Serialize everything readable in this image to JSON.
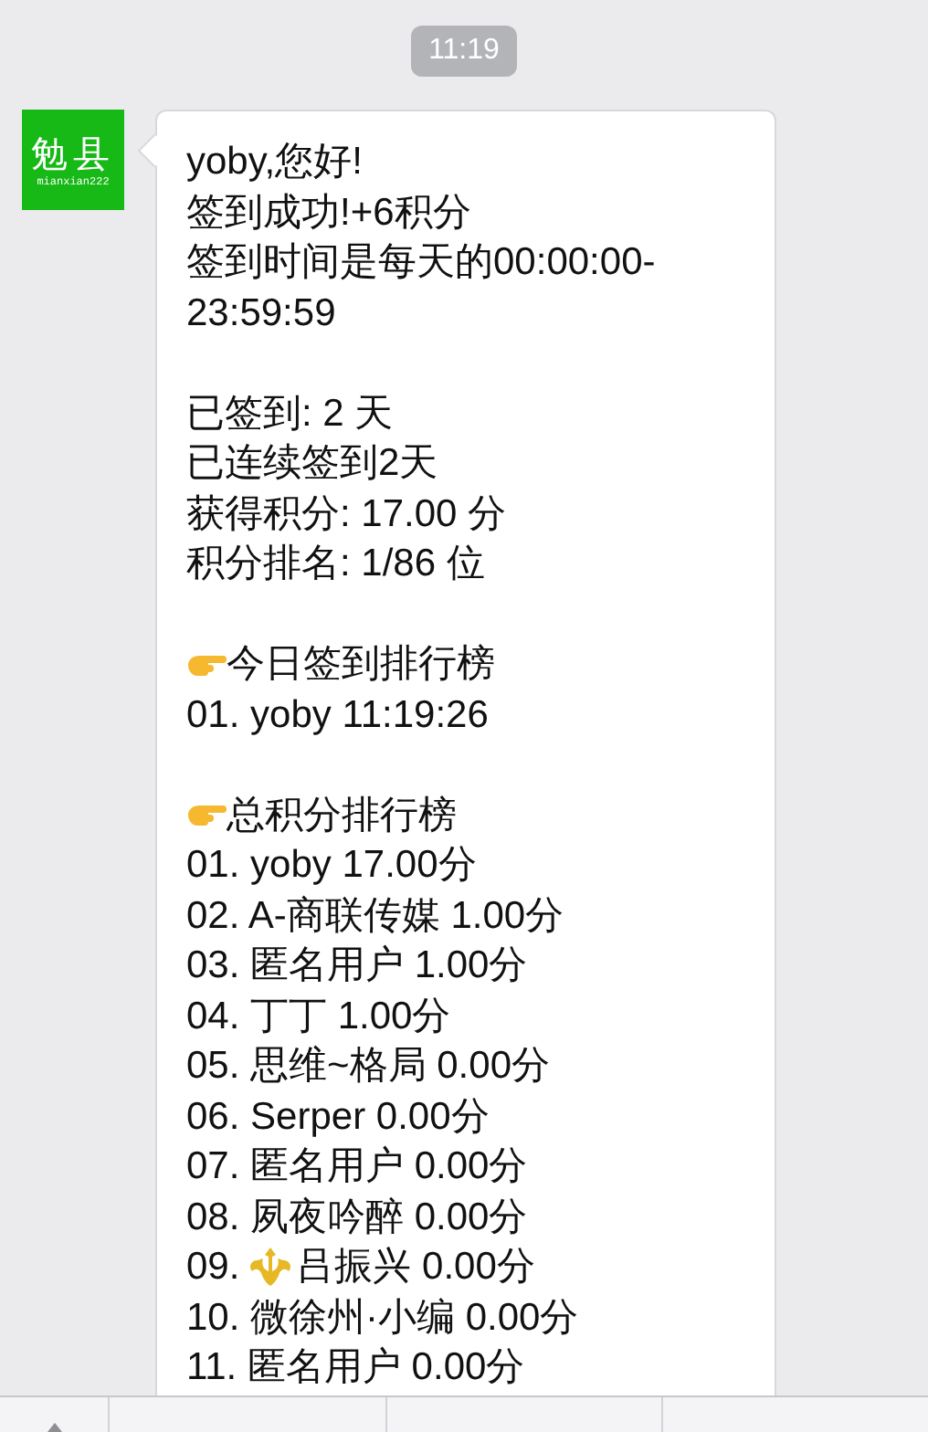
{
  "time_stamp": "11:19",
  "message": {
    "sender_avatar": {
      "title": "勉县",
      "subtitle": "mianxian222"
    },
    "lines": [
      {
        "kind": "plain",
        "text": "yoby,您好!"
      },
      {
        "kind": "plain",
        "text": "签到成功!+6积分"
      },
      {
        "kind": "plain",
        "text": "签到时间是每天的00:00:00-23:59:59"
      },
      {
        "kind": "blank"
      },
      {
        "kind": "plain",
        "text": "已签到: 2 天"
      },
      {
        "kind": "plain",
        "text": "已连续签到2天"
      },
      {
        "kind": "plain",
        "text": "获得积分: 17.00 分"
      },
      {
        "kind": "plain",
        "text": "积分排名: 1/86 位"
      },
      {
        "kind": "blank"
      },
      {
        "kind": "pointer",
        "text": "今日签到排行榜"
      },
      {
        "kind": "plain",
        "text": "01. yoby 11:19:26"
      },
      {
        "kind": "blank"
      },
      {
        "kind": "pointer",
        "text": "总积分排行榜"
      },
      {
        "kind": "plain",
        "text": "01. yoby 17.00分"
      },
      {
        "kind": "plain",
        "text": "02. A-商联传媒 1.00分"
      },
      {
        "kind": "plain",
        "text": "03. 匿名用户 1.00分"
      },
      {
        "kind": "plain",
        "text": "04. 丁丁 1.00分"
      },
      {
        "kind": "plain",
        "text": "05. 思维~格局 0.00分"
      },
      {
        "kind": "plain",
        "text": "06. Serper 0.00分"
      },
      {
        "kind": "plain",
        "text": "07. 匿名用户 0.00分"
      },
      {
        "kind": "plain",
        "text": "08. 夙夜吟醉 0.00分"
      },
      {
        "kind": "emblem",
        "before": "09.",
        "text": "吕振兴 0.00分"
      },
      {
        "kind": "plain",
        "text": "10. 微徐州·小编 0.00分"
      },
      {
        "kind": "plain",
        "text": "11. 匿名用户 0.00分"
      }
    ]
  }
}
